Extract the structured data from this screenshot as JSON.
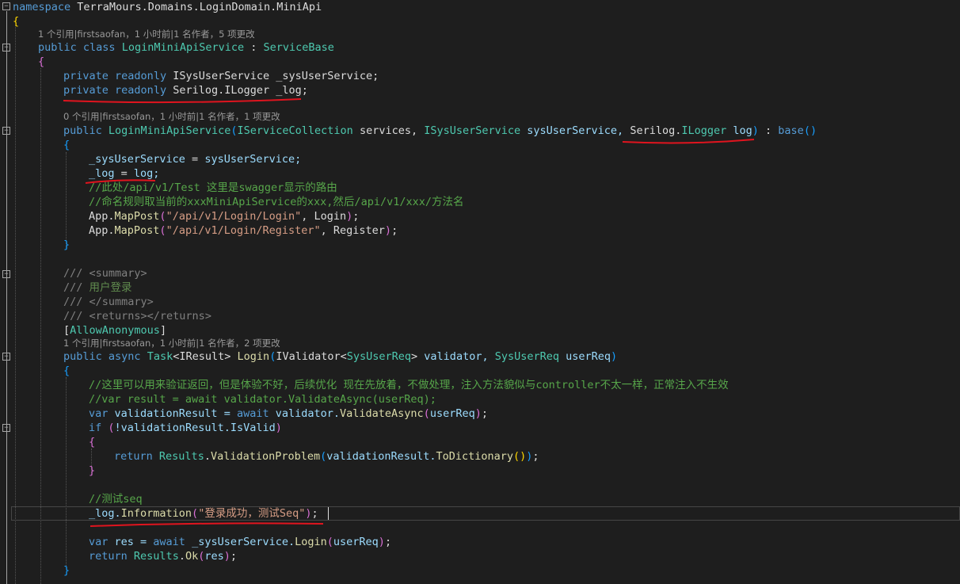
{
  "lenses": {
    "l1": "1 个引用|firstsaofan，1 小时前|1 名作者，5 项更改",
    "l2": "0 个引用|firstsaofan，1 小时前|1 名作者，1 项更改",
    "l3": "1 个引用|firstsaofan，1 小时前|1 名作者，2 项更改"
  },
  "code": {
    "ns_kw": "namespace",
    "ns_name": "TerraMours.Domains.LoginDomain.MiniApi",
    "brace_open": "{",
    "brace_close": "}",
    "public": "public",
    "class": "class",
    "private": "private",
    "readonly": "readonly",
    "async": "async",
    "var": "var",
    "await": "await",
    "if": "if",
    "return": "return",
    "base": "base",
    "class_name": "LoginMiniApiService",
    "colon": " : ",
    "base_class": "ServiceBase",
    "f1_type": "ISysUserService",
    "f1_name": " _sysUserService;",
    "f2_ns": "Serilog.",
    "f2_type": "ILogger",
    "f2_name": " _log;",
    "ctor_name": "LoginMiniApiService",
    "ctor_p1_type": "IServiceCollection",
    "ctor_p1_name": " services, ",
    "ctor_p2_type": "ISysUserService",
    "ctor_p2_name": " sysUserService, ",
    "ctor_p3_ns": "Serilog.",
    "ctor_p3_type": "ILogger",
    "ctor_p3_name": " log",
    "ctor_tail": " : ",
    "a1_left": "_sysUserService",
    "a1_eq": " = ",
    "a1_right": "sysUserService;",
    "a2_left": "_log",
    "a2_eq": " = ",
    "a2_right": "log;",
    "c1": "//此处/api/v1/Test 这里是swagger显示的路由",
    "c2": "//命名规则取当前的xxxMiniApiService的xxx,然后/api/v1/xxx/方法名",
    "map1_obj": "App.",
    "map1_m": "MapPost",
    "map1_s": "\"/api/v1/Login/Login\"",
    "map1_arg": ", Login",
    "map2_obj": "App.",
    "map2_m": "MapPost",
    "map2_s": "\"/api/v1/Login/Register\"",
    "map2_arg": ", Register",
    "d1a": "/// ",
    "d1b": "<summary>",
    "d2a": "/// ",
    "d2b": "用户登录",
    "d3a": "/// ",
    "d3b": "</summary>",
    "d4a": "/// ",
    "d4b": "<returns></returns>",
    "attr_b1": "[",
    "attr_name": "AllowAnonymous",
    "attr_b2": "]",
    "m_type": "Task",
    "m_lt": "<",
    "m_targ": "IResult",
    "m_gt": ">",
    "m_name": "Login",
    "m_p1_type": "IValidator",
    "m_p1_targ": "SysUserReq",
    "m_p1_name": " validator, ",
    "m_p2_type": "SysUserReq",
    "m_p2_name": " userReq",
    "c3": "//这里可以用来验证返回，但是体验不好，后续优化 现在先放着，不做处理，注入方法貌似与controller不太一样，正常注入不生效",
    "c4": "//var result = await validator.ValidateAsync(userReq);",
    "v1_name": " validationResult = ",
    "v1_obj": " validator.",
    "v1_m": "ValidateAsync",
    "v1_arg": "userReq",
    "if_cond": "!validationResult.IsValid",
    "r1_type": "Results",
    "r1_dot": ".",
    "r1_m": "ValidationProblem",
    "r1_obj": "validationResult.",
    "r1_m2": "ToDictionary",
    "c5": "//测试seq",
    "log_obj": "_log.",
    "log_m": "Information",
    "log_s": "\"登录成功，测试Seq\"",
    "v2_name": " res = ",
    "v2_obj": " _sysUserService.",
    "v2_m": "Login",
    "v2_arg": "userReq",
    "r2_type": "Results",
    "r2_m": "Ok",
    "r2_arg": "res"
  }
}
